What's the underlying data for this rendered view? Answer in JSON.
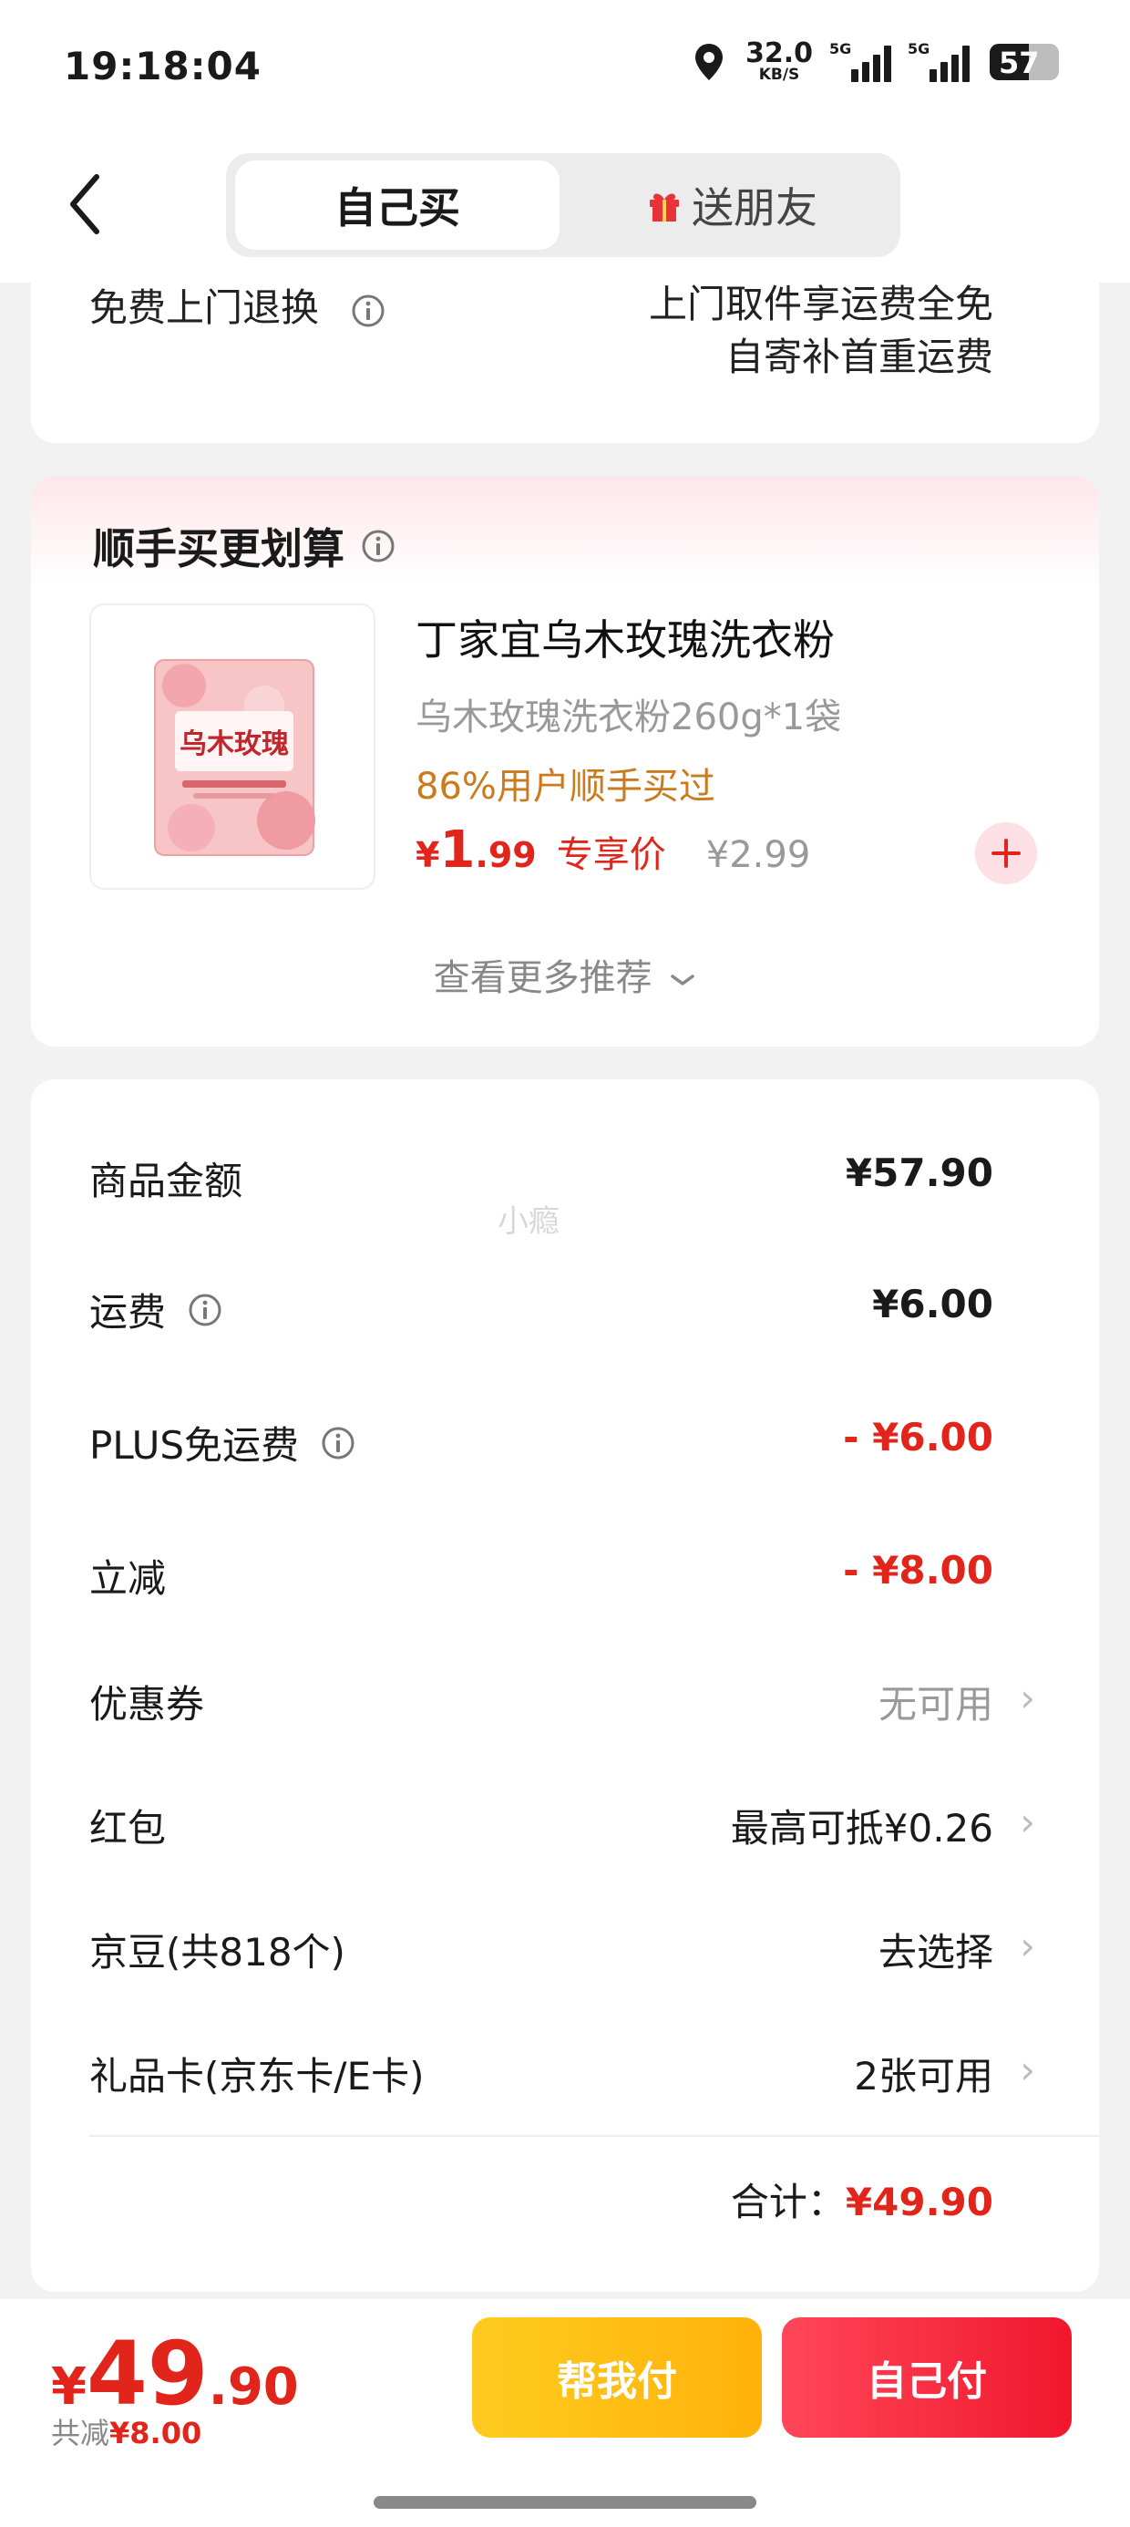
{
  "status_bar": {
    "time": "19:18:04",
    "net_speed_value": "32.0",
    "net_speed_unit": "KB/S",
    "sim1_label": "5G",
    "sim2_label": "5G",
    "battery": "57",
    "battery_level": 0.57
  },
  "header": {
    "tab_self": "自己买",
    "tab_friend": "送朋友"
  },
  "return_section": {
    "label": "免费上门退换",
    "value_line1": "上门取件享运费全免",
    "value_line2": "自寄补首重运费"
  },
  "addon": {
    "title": "顺手买更划算",
    "product_name": "丁家宜乌木玫瑰洗衣粉",
    "product_spec": "乌木玫瑰洗衣粉260g*1袋",
    "product_hint": "86%用户顺手买过",
    "currency": "¥",
    "price_int": "1",
    "price_dec": ".99",
    "price_tag": "专享价",
    "orig_price": "¥2.99",
    "image_text": "乌木玫瑰",
    "more": "查看更多推荐"
  },
  "summary": {
    "rows": [
      {
        "label": "商品金额",
        "value": "¥57.90"
      },
      {
        "label": "运费",
        "value": "¥6.00"
      },
      {
        "label": "PLUS免运费",
        "value": "- ¥6.00"
      },
      {
        "label": "立减",
        "value": "- ¥8.00"
      },
      {
        "label": "优惠券",
        "value": "无可用"
      },
      {
        "label": "红包",
        "value": "最高可抵¥0.26"
      },
      {
        "label": "京豆(共818个)",
        "value": "去选择"
      },
      {
        "label": "礼品卡(京东卡/E卡)",
        "value": "2张可用"
      }
    ],
    "total_label": "合计：",
    "total_value": "¥49.90",
    "watermark": "小瘾"
  },
  "bottom": {
    "currency": "¥",
    "amount_int": "49",
    "amount_dec": ".90",
    "saved_label": "共减",
    "saved_value": "¥8.00",
    "help_pay": "帮我付",
    "self_pay": "自己付"
  },
  "colors": {
    "accent_red": "#e1251b",
    "hint_orange": "#cc7a1e",
    "help_pay_yellow": "#ffb20a",
    "self_pay_red": "#f1172d"
  }
}
